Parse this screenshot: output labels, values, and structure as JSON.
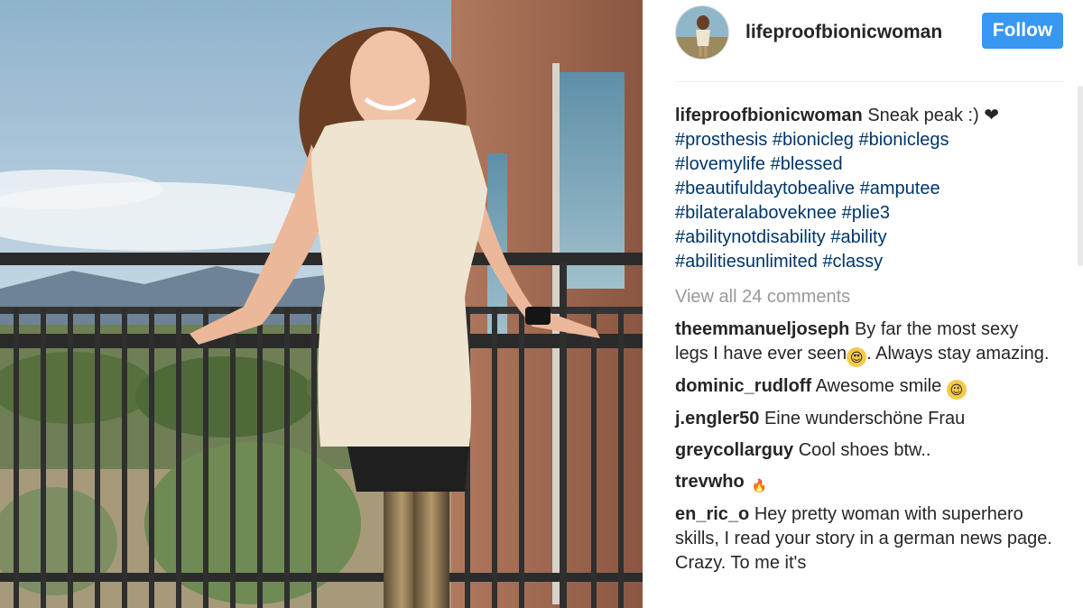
{
  "post": {
    "username": "lifeproofbionicwoman",
    "follow_label": "Follow"
  },
  "caption": {
    "username": "lifeproofbionicwoman",
    "text": "Sneak peak :) ❤",
    "hashtags": [
      "#prosthesis",
      "#bionicleg",
      "#bioniclegs",
      "#lovemylife",
      "#blessed",
      "#beautifuldaytobealive",
      "#amputee",
      "#bilateralaboveknee",
      "#plie3",
      "#abilitynotdisability",
      "#ability",
      "#abilitiesunlimited",
      "#classy"
    ]
  },
  "view_all_comments": "View all 24 comments",
  "comments": [
    {
      "username": "theemmanueljoseph",
      "text_before": "By far the most sexy legs I have ever seen",
      "emoji": "heart-eyes-emoji",
      "text_after": ". Always stay amazing."
    },
    {
      "username": "dominic_rudloff",
      "text_before": "Awesome smile ",
      "emoji": "wink-emoji",
      "text_after": ""
    },
    {
      "username": "j.engler50",
      "text_before": "Eine wunderschöne Frau",
      "emoji": "",
      "text_after": ""
    },
    {
      "username": "greycollarguy",
      "text_before": "Cool shoes btw..",
      "emoji": "",
      "text_after": ""
    },
    {
      "username": "trevwho",
      "text_before": "",
      "emoji": "fire-emoji",
      "text_after": ""
    },
    {
      "username": "en_ric_o",
      "text_before": "Hey pretty woman with superhero skills, I read your story in a german news page. Crazy. To me it's",
      "emoji": "",
      "text_after": ""
    }
  ],
  "colors": {
    "follow_button": "#3897f0",
    "hashtag": "#003569",
    "muted": "#999999"
  }
}
